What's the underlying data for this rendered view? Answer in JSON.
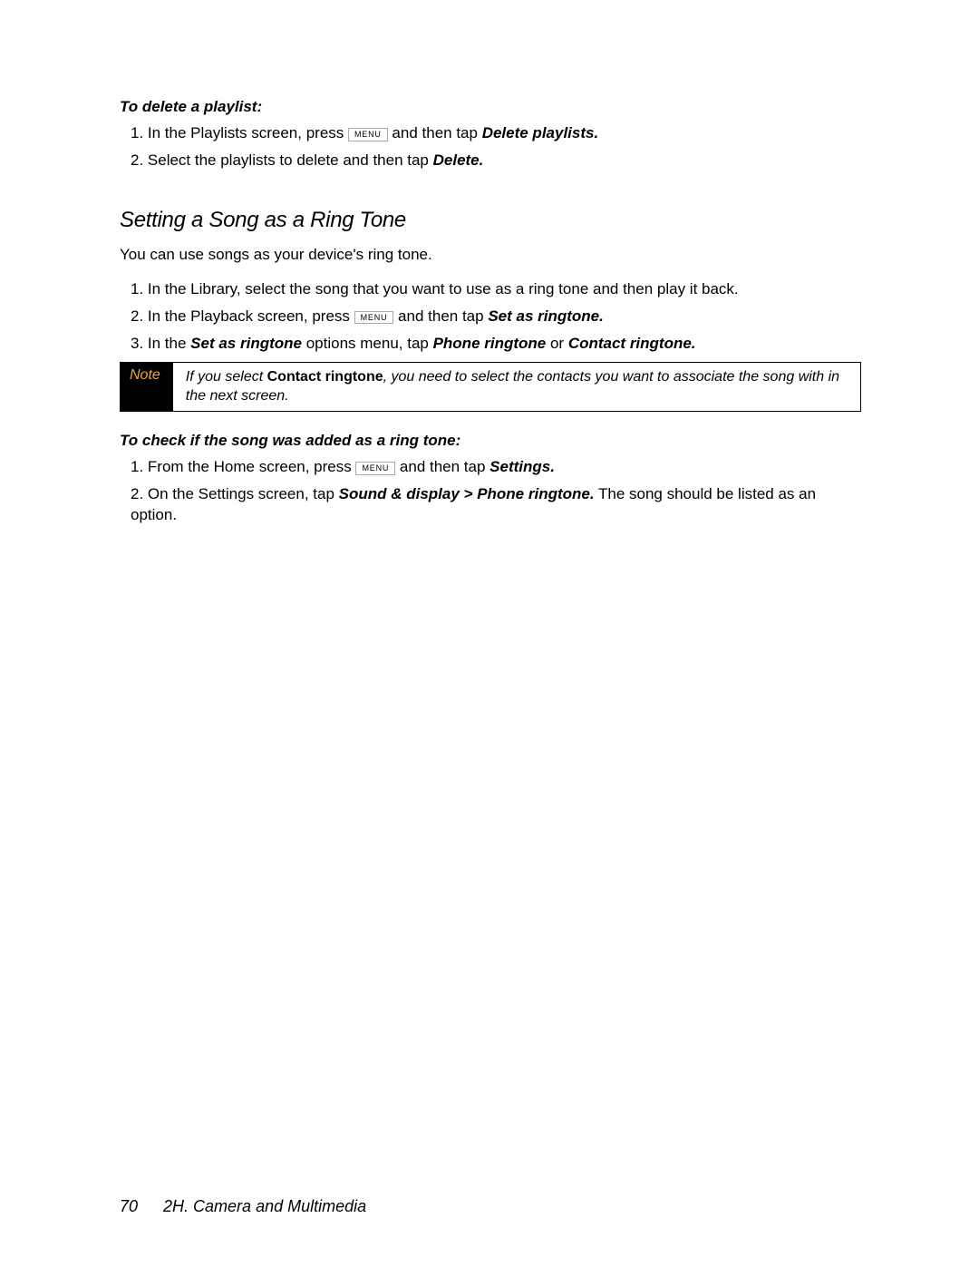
{
  "menu_label": "MENU",
  "section1": {
    "heading": "To delete a playlist:",
    "step1_a": "1. In the Playlists screen, press ",
    "step1_b": " and then tap ",
    "step1_c": "Delete playlists.",
    "step2_a": "2. Select the playlists to delete and then tap ",
    "step2_b": "Delete."
  },
  "section2": {
    "title": "Setting a Song as a Ring Tone",
    "intro": "You can use songs as your device's ring tone.",
    "step1": "1. In the Library, select the song that you want to use as a ring tone and then play it back.",
    "step2_a": "2. In the Playback screen, press ",
    "step2_b": " and then tap ",
    "step2_c": "Set as ringtone.",
    "step3_a": "3. In the ",
    "step3_b": "Set as ringtone",
    "step3_c": " options menu, tap ",
    "step3_d": "Phone ringtone",
    "step3_e": " or ",
    "step3_f": "Contact ringtone."
  },
  "note": {
    "label": "Note",
    "text_a": "If you select ",
    "text_b": "Contact ringtone",
    "text_c": ", you need to select the contacts you want to associate the song with in the next screen."
  },
  "section3": {
    "heading": "To check if the song was added as a ring tone:",
    "step1_a": "1. From the Home screen, press ",
    "step1_b": " and then tap ",
    "step1_c": "Settings.",
    "step2_a": "2. On the Settings screen, tap ",
    "step2_b": "Sound & display > Phone ringtone.",
    "step2_c": " The song should be listed as an option."
  },
  "footer": {
    "page": "70",
    "chapter": "2H. Camera and Multimedia"
  }
}
